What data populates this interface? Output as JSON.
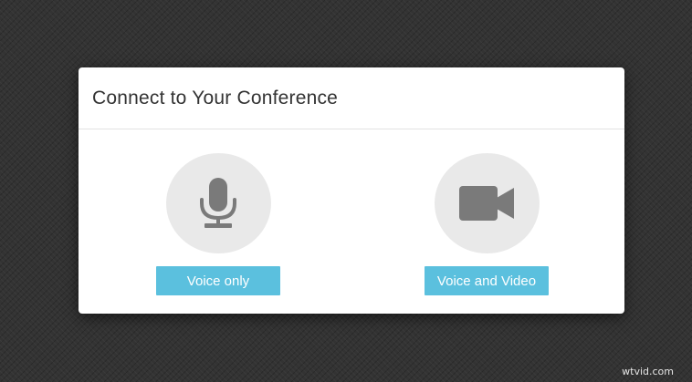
{
  "dialog": {
    "title": "Connect to Your Conference",
    "options": [
      {
        "label": "Voice only",
        "icon": "microphone-icon"
      },
      {
        "label": "Voice and Video",
        "icon": "video-camera-icon"
      }
    ]
  },
  "watermark": {
    "text": "wtvid.com"
  },
  "colors": {
    "background": "#333333",
    "dialog": "#ffffff",
    "accent_button": "#5bc0de",
    "icon_circle": "#e9e9e9",
    "icon": "#7a7a7a"
  }
}
